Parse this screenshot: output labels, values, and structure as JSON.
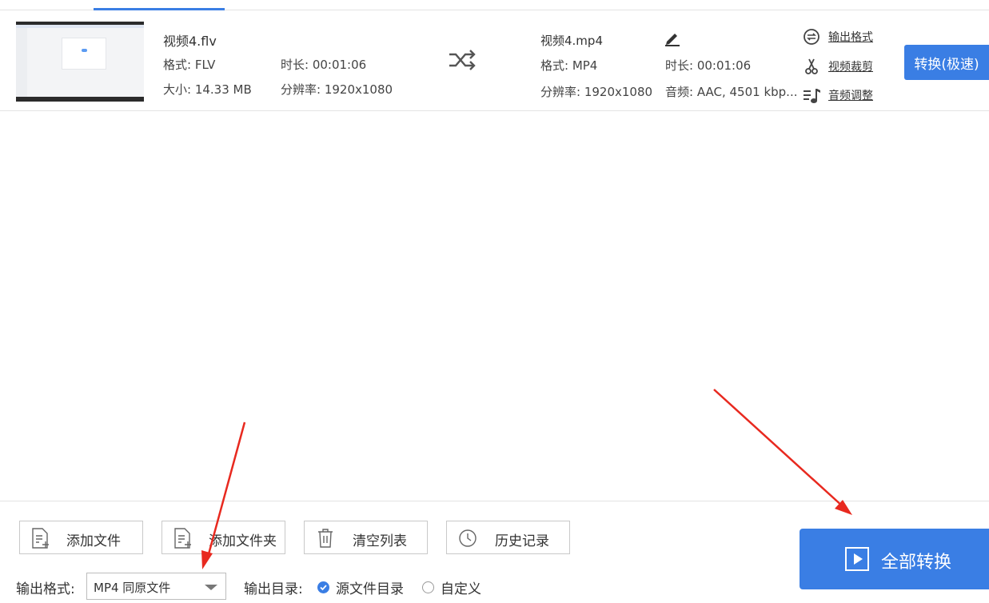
{
  "source": {
    "name": "视频4.flv",
    "format": "格式: FLV",
    "size": "大小: 14.33 MB",
    "duration": "时长: 00:01:06",
    "resolution": "分辨率: 1920x1080"
  },
  "target": {
    "name": "视频4.mp4",
    "format": "格式: MP4",
    "resolution": "分辨率: 1920x1080",
    "duration": "时长: 00:01:06",
    "audio": "音频: AAC, 4501 kbp..."
  },
  "actions": {
    "output_format": "输出格式",
    "video_crop": "视频裁剪",
    "audio_adjust": "音频调整"
  },
  "convert_button": "转换(极速)",
  "toolbar": {
    "add_file": "添加文件",
    "add_folder": "添加文件夹",
    "clear_list": "清空列表",
    "history": "历史记录"
  },
  "convert_all": "全部转换",
  "output": {
    "format_label": "输出格式:",
    "format_value": "MP4 同原文件",
    "dir_label": "输出目录:",
    "dir_option_source": "源文件目录",
    "dir_option_custom": "自定义",
    "dir_selected": "源文件目录"
  },
  "colors": {
    "accent": "#3a7ee4",
    "annotation": "#e8291f"
  }
}
